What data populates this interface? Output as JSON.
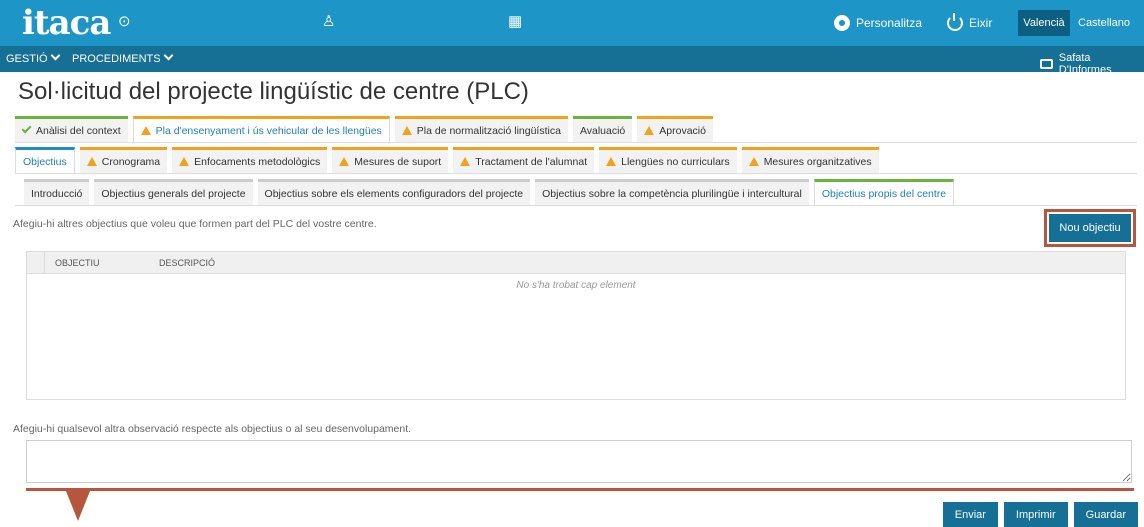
{
  "header": {
    "logo": "itaca",
    "icons": [
      "user-circle-icon",
      "hierarchy-icon",
      "calendar-icon"
    ],
    "personalitza": "Personalitza",
    "eixir": "Eixir",
    "lang_active": "Valencià",
    "lang_other": "Castellano"
  },
  "subbar": {
    "gestio": "GESTIÓ",
    "procediments": "PROCEDIMENTS",
    "safata": "Safata D'Informes"
  },
  "page": {
    "title": "Sol·licitud del projecte lingüístic de centre (PLC)"
  },
  "tabs_level1": [
    {
      "label": "Anàlisi del context",
      "status": "ok"
    },
    {
      "label": "Pla d'ensenyament i ús vehicular de les llengües",
      "status": "warn",
      "active": true
    },
    {
      "label": "Pla de normalització lingüística",
      "status": "warn"
    },
    {
      "label": "Avaluació",
      "status": "none"
    },
    {
      "label": "Aprovació",
      "status": "warn"
    }
  ],
  "tabs_level2": [
    {
      "label": "Objectius",
      "status": "none",
      "active": true
    },
    {
      "label": "Cronograma",
      "status": "warn"
    },
    {
      "label": "Enfocaments metodològics",
      "status": "warn"
    },
    {
      "label": "Mesures de suport",
      "status": "warn"
    },
    {
      "label": "Tractament de l'alumnat",
      "status": "warn"
    },
    {
      "label": "Llengües no curriculars",
      "status": "warn"
    },
    {
      "label": "Mesures organitzatives",
      "status": "warn"
    }
  ],
  "tabs_level3": [
    {
      "label": "Introducció"
    },
    {
      "label": "Objectius generals del projecte"
    },
    {
      "label": "Objectius sobre els elements configuradors del projecte"
    },
    {
      "label": "Objectius sobre la competència plurilingüe i intercultural"
    },
    {
      "label": "Objectius propis del centre",
      "active": true
    }
  ],
  "content": {
    "help_text": "Afegiu-hi altres objectius que voleu que formen part del PLC del vostre centre.",
    "new_button": "Nou objectiu",
    "columns": [
      "OBJECTIU",
      "DESCRIPCIÓ"
    ],
    "empty_text": "No s'ha trobat cap element",
    "obs_label": "Afegiu-hi qualsevol altra observació respecte als objectius o al seu desenvolupament.",
    "obs_value": ""
  },
  "actions": {
    "send": "Enviar",
    "print": "Imprimir",
    "save": "Guardar"
  },
  "colors": {
    "topbar": "#1d95c7",
    "subbar": "#166f95",
    "warning": "#f0a21c",
    "ok": "#6cb33e",
    "highlight": "#b4573c"
  }
}
